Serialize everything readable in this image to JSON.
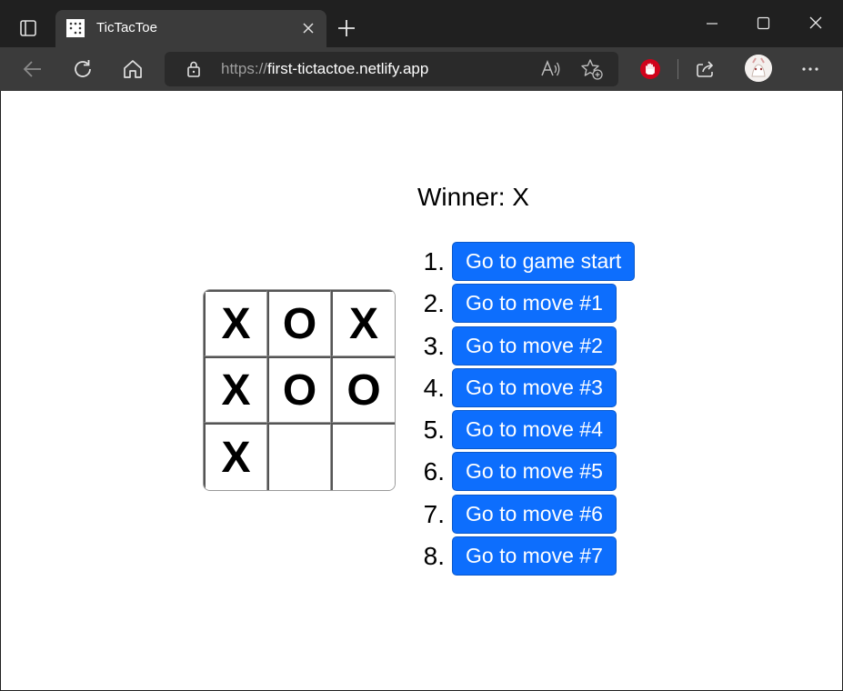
{
  "browser": {
    "tab_title": "TicTacToe",
    "url_protocol": "https://",
    "url_host": "first-tictactoe.netlify.app"
  },
  "game": {
    "status": "Winner: X",
    "board": [
      "X",
      "O",
      "X",
      "X",
      "O",
      "O",
      "X",
      "",
      ""
    ],
    "moves": [
      {
        "number": "1.",
        "label": "Go to game start"
      },
      {
        "number": "2.",
        "label": "Go to move #1"
      },
      {
        "number": "3.",
        "label": "Go to move #2"
      },
      {
        "number": "4.",
        "label": "Go to move #3"
      },
      {
        "number": "5.",
        "label": "Go to move #4"
      },
      {
        "number": "6.",
        "label": "Go to move #5"
      },
      {
        "number": "7.",
        "label": "Go to move #6"
      },
      {
        "number": "8.",
        "label": "Go to move #7"
      }
    ]
  },
  "colors": {
    "button": "#0d6efd",
    "chrome_dark": "#202020",
    "chrome_tab": "#3b3b3b"
  }
}
